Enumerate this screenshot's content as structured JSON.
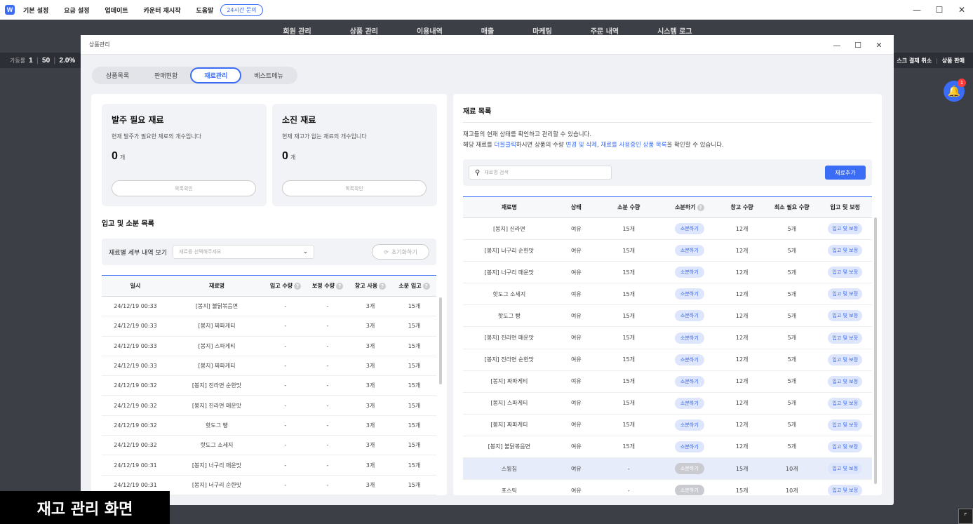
{
  "topbar": {
    "logo": "W",
    "menu": [
      "기본 설정",
      "요금 설정",
      "업데이트",
      "카운터 재시작",
      "도움말"
    ],
    "support_button": "24시간 문의",
    "window_controls": [
      "—",
      "☐",
      "✕"
    ]
  },
  "background": {
    "nav": [
      "회원 관리",
      "상품 관리",
      "이용내역",
      "매출",
      "마케팅",
      "주문 내역",
      "시스템 로그"
    ],
    "stats": {
      "label": "가동률",
      "values": [
        "1",
        "50",
        "2.0%"
      ]
    },
    "right_links": [
      "스크 결제 취소",
      "상품 판매"
    ],
    "bell_badge": "1"
  },
  "modal": {
    "title": "상품관리",
    "controls": [
      "—",
      "☐",
      "✕"
    ],
    "tabs": [
      "상품목록",
      "판매현황",
      "재료관리",
      "베스트메뉴"
    ],
    "active_tab": "재료관리"
  },
  "left": {
    "cards": [
      {
        "title": "발주 필요 재료",
        "desc": "현재 발주가 필요한 재료의 개수입니다",
        "count": "0",
        "unit": "개",
        "button": "목록확인"
      },
      {
        "title": "소진 재료",
        "desc": "현재 재고가 없는 재료의 개수입니다",
        "count": "0",
        "unit": "개",
        "button": "목록확인"
      }
    ],
    "section_title": "입고 및 소분 목록",
    "filter_label": "재료별 세부 내역 보기",
    "select_placeholder": "재료를 선택해주세요",
    "reset_button": "초기화하기",
    "columns": [
      "일시",
      "재료명",
      "입고 수량",
      "보정 수량",
      "창고 사용",
      "소분 입고"
    ],
    "rows": [
      [
        "24/12/19 00:33",
        "[봉지] 불닭볶음면",
        "-",
        "-",
        "3개",
        "15개"
      ],
      [
        "24/12/19 00:33",
        "[봉지] 짜파게티",
        "-",
        "-",
        "3개",
        "15개"
      ],
      [
        "24/12/19 00:33",
        "[봉지] 스파게티",
        "-",
        "-",
        "3개",
        "15개"
      ],
      [
        "24/12/19 00:33",
        "[봉지] 짜파게티",
        "-",
        "-",
        "3개",
        "15개"
      ],
      [
        "24/12/19 00:32",
        "[봉지] 진라면 순한맛",
        "-",
        "-",
        "3개",
        "15개"
      ],
      [
        "24/12/19 00:32",
        "[봉지] 진라면 매운맛",
        "-",
        "-",
        "3개",
        "15개"
      ],
      [
        "24/12/19 00:32",
        "핫도그 빵",
        "-",
        "-",
        "3개",
        "15개"
      ],
      [
        "24/12/19 00:32",
        "핫도그 소세지",
        "-",
        "-",
        "3개",
        "15개"
      ],
      [
        "24/12/19 00:31",
        "[봉지] 너구리 매운맛",
        "-",
        "-",
        "3개",
        "15개"
      ],
      [
        "24/12/19 00:31",
        "[봉지] 너구리 순한맛",
        "-",
        "-",
        "3개",
        "15개"
      ]
    ]
  },
  "right": {
    "title": "재료 목록",
    "desc_line1": "재고들의 현재 상태를 확인하고 관리할 수 있습니다.",
    "desc_line2_a": "해당 재료를 ",
    "desc_line2_hl1": "더블클릭",
    "desc_line2_b": "하시면 상품의 수량 ",
    "desc_line2_hl2": "변경 및 삭제",
    "desc_line2_c": ", ",
    "desc_line2_hl3": "재료를 사용중인 상품 목록",
    "desc_line2_d": "을 확인할 수 있습니다.",
    "search_placeholder": "재료명 검색",
    "add_button": "재료추가",
    "columns": [
      "재료명",
      "상태",
      "소분 수량",
      "소분하기",
      "창고 수량",
      "최소 필요 수량",
      "입고 및 보정"
    ],
    "rows": [
      {
        "name": "[봉지] 신라면",
        "status": "여유",
        "portion": "15개",
        "action": "소분하기",
        "stock": "12개",
        "min": "5개",
        "adjust": "입고 및 보정",
        "disabled": false
      },
      {
        "name": "[봉지] 너구리 순한맛",
        "status": "여유",
        "portion": "15개",
        "action": "소분하기",
        "stock": "12개",
        "min": "5개",
        "adjust": "입고 및 보정",
        "disabled": false
      },
      {
        "name": "[봉지] 너구리 매운맛",
        "status": "여유",
        "portion": "15개",
        "action": "소분하기",
        "stock": "12개",
        "min": "5개",
        "adjust": "입고 및 보정",
        "disabled": false
      },
      {
        "name": "핫도그 소세지",
        "status": "여유",
        "portion": "15개",
        "action": "소분하기",
        "stock": "12개",
        "min": "5개",
        "adjust": "입고 및 보정",
        "disabled": false
      },
      {
        "name": "핫도그 빵",
        "status": "여유",
        "portion": "15개",
        "action": "소분하기",
        "stock": "12개",
        "min": "5개",
        "adjust": "입고 및 보정",
        "disabled": false
      },
      {
        "name": "[봉지] 진라면 매운맛",
        "status": "여유",
        "portion": "15개",
        "action": "소분하기",
        "stock": "12개",
        "min": "5개",
        "adjust": "입고 및 보정",
        "disabled": false
      },
      {
        "name": "[봉지] 진라면 순한맛",
        "status": "여유",
        "portion": "15개",
        "action": "소분하기",
        "stock": "12개",
        "min": "5개",
        "adjust": "입고 및 보정",
        "disabled": false
      },
      {
        "name": "[봉지] 짜파게티",
        "status": "여유",
        "portion": "15개",
        "action": "소분하기",
        "stock": "12개",
        "min": "5개",
        "adjust": "입고 및 보정",
        "disabled": false
      },
      {
        "name": "[봉지] 스파게티",
        "status": "여유",
        "portion": "15개",
        "action": "소분하기",
        "stock": "12개",
        "min": "5개",
        "adjust": "입고 및 보정",
        "disabled": false
      },
      {
        "name": "[봉지] 짜파게티",
        "status": "여유",
        "portion": "15개",
        "action": "소분하기",
        "stock": "12개",
        "min": "5개",
        "adjust": "입고 및 보정",
        "disabled": false
      },
      {
        "name": "[봉지] 불닭볶음면",
        "status": "여유",
        "portion": "15개",
        "action": "소분하기",
        "stock": "12개",
        "min": "5개",
        "adjust": "입고 및 보정",
        "disabled": false
      },
      {
        "name": "스윙칩",
        "status": "여유",
        "portion": "-",
        "action": "소분하기",
        "stock": "15개",
        "min": "10개",
        "adjust": "입고 및 보정",
        "disabled": true,
        "selected": true
      },
      {
        "name": "포스틱",
        "status": "여유",
        "portion": "-",
        "action": "소분하기",
        "stock": "15개",
        "min": "10개",
        "adjust": "입고 및 보정",
        "disabled": true
      }
    ]
  },
  "caption": "재고 관리 화면",
  "colors": {
    "accent": "#3b6cf5",
    "background": "#3d3f47"
  }
}
